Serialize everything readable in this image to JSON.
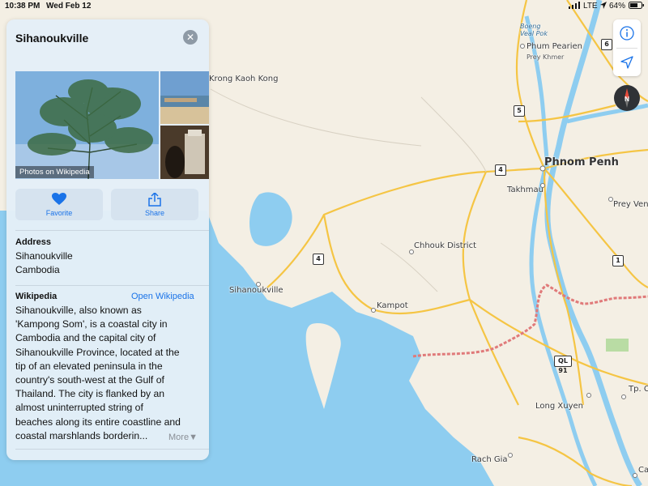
{
  "status_bar": {
    "time": "10:38 PM",
    "date": "Wed Feb 12",
    "network": "LTE",
    "battery": "64%"
  },
  "place_card": {
    "title": "Sihanoukville",
    "photos_caption": "Photos on Wikipedia",
    "actions": [
      {
        "label": "Favorite",
        "icon": "heart-icon"
      },
      {
        "label": "Share",
        "icon": "share-icon"
      }
    ],
    "address": {
      "heading": "Address",
      "line1": "Sihanoukville",
      "line2": "Cambodia"
    },
    "wikipedia": {
      "heading": "Wikipedia",
      "link": "Open Wikipedia",
      "lines": [
        "Sihanoukville, also known as",
        "'Kampong Som', is a coastal city in",
        "Cambodia and the capital city of",
        "Sihanoukville Province, located at the",
        "tip of an elevated peninsula in the",
        "country's south-west at the Gulf of",
        "Thailand. The city is flanked by an",
        "almost uninterrupted string of",
        "beaches along its entire coastline and",
        "coastal marshlands borderin..."
      ],
      "more": "More"
    }
  },
  "map_labels": {
    "krong_kaoh_kong": "Krong Kaoh Kong",
    "boeng_veal_pok": "Boeng Veal Pok",
    "phum_pearien": "Phum Pearien",
    "prey_khmer": "Prey Khmer",
    "phnom_penh": "Phnom Penh",
    "takhmau": "Takhmau",
    "prey_ven": "Prey Ven",
    "chhouk_district": "Chhouk District",
    "sihanoukville": "Sihanoukville",
    "kampot": "Kampot",
    "long_xuyen": "Long Xuyen",
    "rach_gia": "Rach Gia",
    "tp_c": "Tp. C",
    "ca": "Ca"
  },
  "road_shields": [
    "6",
    "5",
    "4",
    "4",
    "1",
    "QL 91"
  ],
  "map_controls": [
    {
      "name": "info-button",
      "icon": "info-icon"
    },
    {
      "name": "location-button",
      "icon": "location-arrow-icon"
    },
    {
      "name": "compass",
      "icon": "compass-icon",
      "label": "N"
    }
  ],
  "colors": {
    "water": "#8ecdf0",
    "land": "#f4efe4",
    "road": "#f5c544",
    "border": "#e07a7a",
    "accent": "#1a73e8"
  }
}
